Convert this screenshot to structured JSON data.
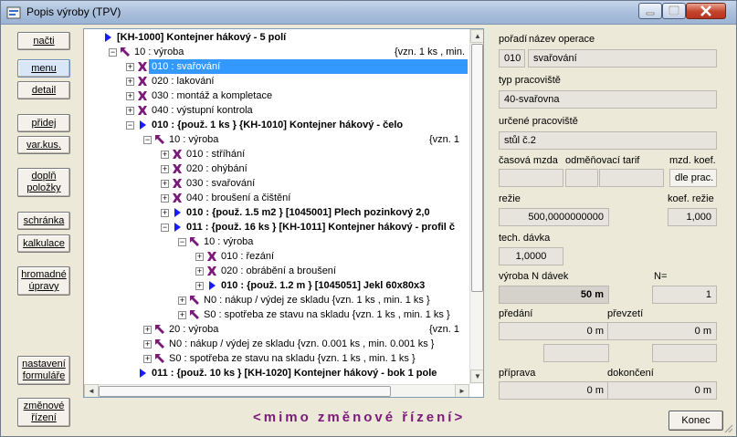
{
  "window": {
    "title": "Popis výroby (TPV)"
  },
  "left_buttons": [
    {
      "name": "nacti-button",
      "label": "načti",
      "active": false
    },
    {
      "name": "menu-button",
      "label": "menu",
      "active": true
    },
    {
      "name": "detail-button",
      "label": "detail",
      "active": false
    },
    {
      "name": "pridej-button",
      "label": "přidej",
      "active": false
    },
    {
      "name": "var-kus-button",
      "label": "var.kus.",
      "active": false
    },
    {
      "name": "dopln-polozky-button",
      "label": "doplň\npoložky",
      "active": false
    },
    {
      "name": "schranka-button",
      "label": "schránka",
      "active": false
    },
    {
      "name": "kalkulace-button",
      "label": "kalkulace",
      "active": false
    },
    {
      "name": "hromadne-upravy-button",
      "label": "hromadné\núpravy",
      "active": false
    },
    {
      "name": "nastaveni-formulare-button",
      "label": "nastavení\nformuláře",
      "active": false
    },
    {
      "name": "zmenove-rizeni-button",
      "label": "změnové\nřízení",
      "active": false
    }
  ],
  "tree": [
    {
      "level": 0,
      "exp": "",
      "icon": "triangle",
      "text": "[KH-1000] Kontejner hákový - 5 polí",
      "bold": true,
      "extra": ""
    },
    {
      "level": 1,
      "exp": "-",
      "icon": "arrow",
      "text": "10 : výroba",
      "bold": false,
      "extra": "{vzn. 1  ks , min."
    },
    {
      "level": 2,
      "exp": "+",
      "icon": "x",
      "text": "010 : svařování",
      "bold": false,
      "extra": "",
      "selected": true
    },
    {
      "level": 2,
      "exp": "+",
      "icon": "x",
      "text": "020 : lakování",
      "bold": false,
      "extra": ""
    },
    {
      "level": 2,
      "exp": "+",
      "icon": "x",
      "text": "030 : montáž a kompletace",
      "bold": false,
      "extra": ""
    },
    {
      "level": 2,
      "exp": "+",
      "icon": "x",
      "text": "040 : výstupní kontrola",
      "bold": false,
      "extra": ""
    },
    {
      "level": 2,
      "exp": "-",
      "icon": "triangle",
      "text": "010 : {použ. 1  ks } {KH-1010] Kontejner hákový - čelo",
      "bold": true,
      "extra": ""
    },
    {
      "level": 3,
      "exp": "-",
      "icon": "arrow",
      "text": "10 : výroba",
      "bold": false,
      "extra": "{vzn. 1"
    },
    {
      "level": 4,
      "exp": "+",
      "icon": "x",
      "text": "010 : stříhání",
      "bold": false,
      "extra": ""
    },
    {
      "level": 4,
      "exp": "+",
      "icon": "x",
      "text": "020 : ohýbání",
      "bold": false,
      "extra": ""
    },
    {
      "level": 4,
      "exp": "+",
      "icon": "x",
      "text": "030 : svařování",
      "bold": false,
      "extra": ""
    },
    {
      "level": 4,
      "exp": "+",
      "icon": "x",
      "text": "040 : broušení a čištění",
      "bold": false,
      "extra": ""
    },
    {
      "level": 4,
      "exp": "+",
      "icon": "triangle",
      "text": "010 : {použ. 1.5  m2 } [1045001] Plech pozinkový 2,0",
      "bold": true,
      "extra": ""
    },
    {
      "level": 4,
      "exp": "-",
      "icon": "triangle",
      "text": "011 : {použ. 16  ks } [KH-1011] Kontejner hákový - profil č",
      "bold": true,
      "extra": ""
    },
    {
      "level": 5,
      "exp": "-",
      "icon": "arrow",
      "text": "10 : výroba",
      "bold": false,
      "extra": ""
    },
    {
      "level": 6,
      "exp": "+",
      "icon": "x",
      "text": "010 : řezání",
      "bold": false,
      "extra": ""
    },
    {
      "level": 6,
      "exp": "+",
      "icon": "x",
      "text": "020 : obrábění a broušení",
      "bold": false,
      "extra": ""
    },
    {
      "level": 6,
      "exp": "+",
      "icon": "triangle",
      "text": "010 : {použ. 1.2  m } [1045051] Jekl  60x80x3",
      "bold": true,
      "extra": ""
    },
    {
      "level": 5,
      "exp": "+",
      "icon": "arrow",
      "text": "N0 : nákup / výdej ze skladu {vzn. 1  ks , min. 1  ks }",
      "bold": false,
      "extra": ""
    },
    {
      "level": 5,
      "exp": "+",
      "icon": "arrow",
      "text": "S0 : spotřeba ze stavu na skladu {vzn. 1  ks , min. 1  ks }",
      "bold": false,
      "extra": ""
    },
    {
      "level": 3,
      "exp": "+",
      "icon": "arrow",
      "text": "20 : výroba",
      "bold": false,
      "extra": "{vzn. 1"
    },
    {
      "level": 3,
      "exp": "+",
      "icon": "arrow",
      "text": "N0 : nákup / výdej ze skladu {vzn. 0.001  ks , min. 0.001  ks }",
      "bold": false,
      "extra": ""
    },
    {
      "level": 3,
      "exp": "+",
      "icon": "arrow",
      "text": "S0 : spotřeba ze stavu na skladu {vzn. 1  ks , min. 1  ks }",
      "bold": false,
      "extra": ""
    },
    {
      "level": 2,
      "exp": "",
      "icon": "triangle",
      "text": "011 : {použ. 10  ks } [KH-1020] Kontejner hákový - bok 1 pole",
      "bold": true,
      "extra": ""
    }
  ],
  "detail": {
    "poradi_label": "pořadí",
    "nazev_label": "název operace",
    "poradi_value": "010",
    "nazev_value": "svařování",
    "typ_label": "typ pracoviště",
    "typ_value": "40-svařovna",
    "urcene_label": "určené pracoviště",
    "urcene_value": "stůl č.2",
    "casova_label": "časová mzda",
    "tarif_label": "odměňovací tarif",
    "mzd_label": "mzd. koef.",
    "mzd_value": "dle prac.",
    "rezie_label": "režie",
    "rezie_value": "500,0000000000",
    "koef_rezie_label": "koef. režie",
    "koef_rezie_value": "1,000",
    "tech_label": "tech. dávka",
    "tech_value": "1,0000",
    "vyroba_label": "výroba N dávek",
    "vyroba_value": "50 m",
    "n_label": "N=",
    "n_value": "1",
    "predani_label": "předání",
    "predani_value": "0 m",
    "prevzeti_label": "převzetí",
    "prevzeti_value": "0 m",
    "priprava_label": "příprava",
    "priprava_value": "0 m",
    "dokonceni_label": "dokončení",
    "dokonceni_value": "0 m"
  },
  "status_text": "<mimo změnové řízení>",
  "konec_label": "Konec",
  "colors": {
    "selection": "#3399ff",
    "status": "#7a1b7a",
    "icon_blue": "#1a1aff",
    "icon_purple": "#7a1b7a"
  }
}
